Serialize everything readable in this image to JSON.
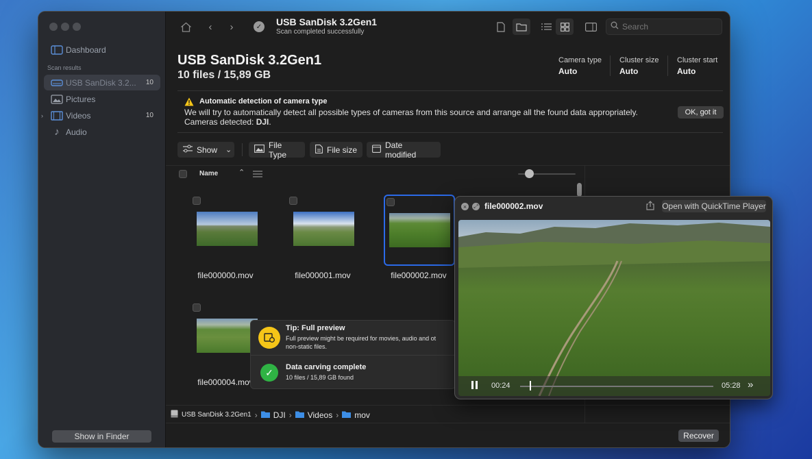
{
  "sidebar": {
    "dashboard": "Dashboard",
    "section": "Scan results",
    "items": [
      {
        "label": "USB  SanDisk 3.2...",
        "count": "10"
      },
      {
        "label": "Pictures",
        "count": ""
      },
      {
        "label": "Videos",
        "count": "10"
      },
      {
        "label": "Audio",
        "count": ""
      }
    ],
    "show_finder": "Show in Finder"
  },
  "toolbar": {
    "title": "USB  SanDisk 3.2Gen1",
    "subtitle": "Scan completed successfully",
    "search_placeholder": "Search"
  },
  "header": {
    "title": "USB  SanDisk 3.2Gen1",
    "subtitle": "10 files / 15,89 GB",
    "stats": [
      {
        "label": "Camera type",
        "value": "Auto"
      },
      {
        "label": "Cluster size",
        "value": "Auto"
      },
      {
        "label": "Cluster start",
        "value": "Auto"
      }
    ]
  },
  "notice": {
    "title": "Automatic detection of camera type",
    "line1": "We will try to automatically detect all possible types of cameras from this source and arrange all the found data appropriately.",
    "line2_prefix": "Cameras detected: ",
    "detected": "DJI",
    "line2_suffix": ".",
    "button": "OK, got it"
  },
  "filters": {
    "show": "Show",
    "file_type": "File Type",
    "file_size": "File size",
    "date_modified": "Date modified"
  },
  "columns": {
    "name": "Name"
  },
  "files": [
    "file000000.mov",
    "file000001.mov",
    "file000002.mov",
    "file000004.mov"
  ],
  "preview": {
    "filename": "file000002.mov",
    "open_with": "Open with QuickTime Player",
    "current_time": "00:24",
    "remaining": "05:28",
    "progress": 0.05
  },
  "toast": {
    "tip_title": "Tip: Full preview",
    "tip_line1": "Full preview might be required for movies, audio and ot",
    "tip_line2": "non-static files.",
    "done_title": "Data carving complete",
    "done_sub": "10 files / 15,89 GB found"
  },
  "path": {
    "device": "USB  SanDisk 3.2Gen1",
    "segments": [
      "DJI",
      "Videos",
      "mov"
    ]
  },
  "footer": {
    "recover": "Recover"
  },
  "colors": {
    "accent": "#3a7bf5",
    "selection": "#2b6ae8",
    "warning": "#f5c518",
    "success": "#2fb344"
  }
}
